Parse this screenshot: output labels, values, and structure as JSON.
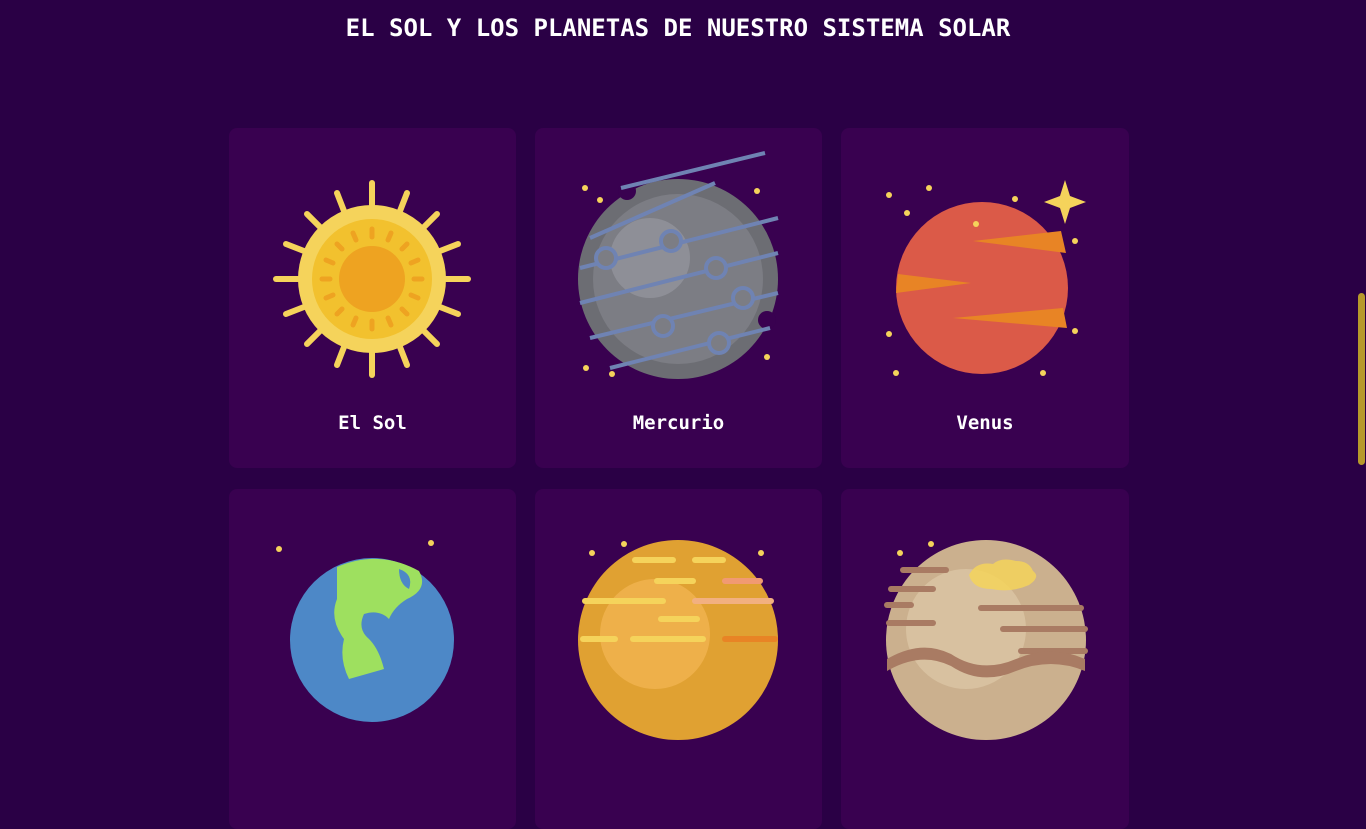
{
  "page": {
    "title": "EL SOL Y LOS PLANETAS DE NUESTRO SISTEMA SOLAR"
  },
  "cards": [
    {
      "label": "El Sol",
      "icon": "sun-icon"
    },
    {
      "label": "Mercurio",
      "icon": "mercury-icon"
    },
    {
      "label": "Venus",
      "icon": "venus-icon"
    },
    {
      "label": "",
      "icon": "earth-icon"
    },
    {
      "label": "",
      "icon": "mars-icon"
    },
    {
      "label": "",
      "icon": "jupiter-icon"
    }
  ],
  "colors": {
    "background": "#2a0045",
    "card": "#390150",
    "star": "#f5d35b",
    "scrollbar": "#b79a2a"
  }
}
